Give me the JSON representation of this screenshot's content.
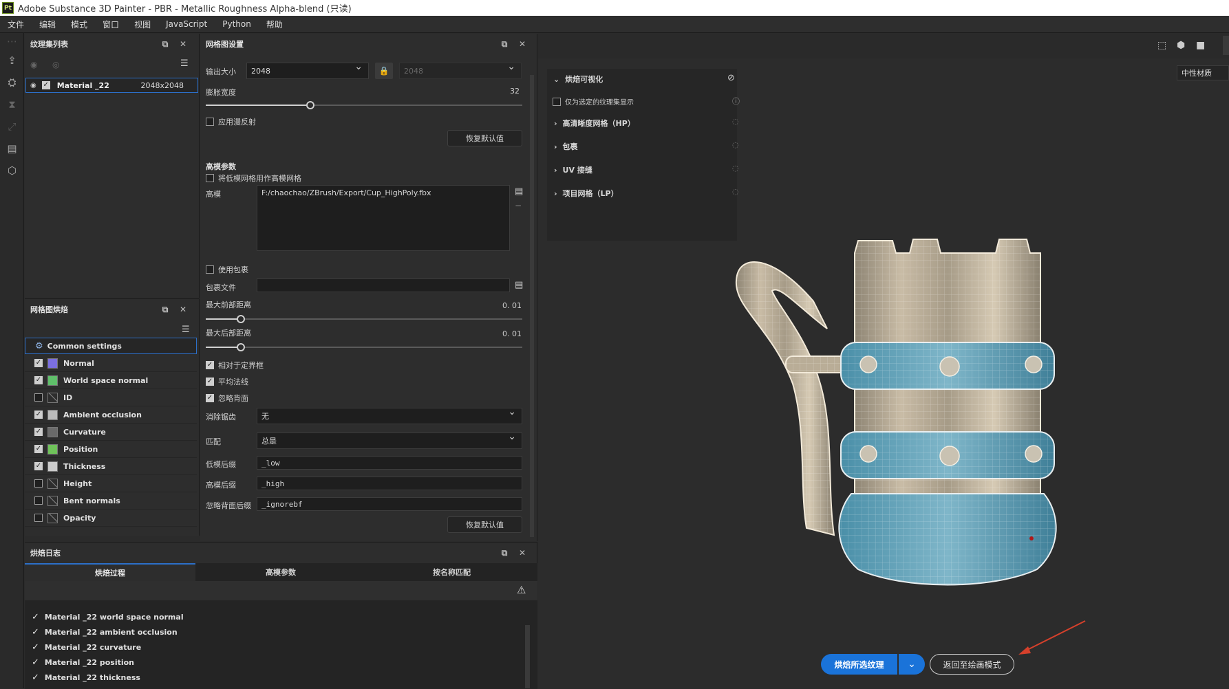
{
  "window": {
    "title": "Adobe Substance 3D Painter - PBR - Metallic Roughness Alpha-blend (只读)",
    "logo": "Pt"
  },
  "menu": [
    "文件",
    "编辑",
    "模式",
    "窗口",
    "视图",
    "JavaScript",
    "Python",
    "帮助"
  ],
  "texture_sets": {
    "title": "纹理集列表",
    "item": {
      "name": "Material _22",
      "size": "2048x2048"
    }
  },
  "mesh_settings": {
    "title": "网格图设置",
    "output_size_label": "输出大小",
    "output_size": "2048",
    "output_size_locked": "2048",
    "dilation_label": "膨胀宽度",
    "dilation_value": "32",
    "dilation_fraction": 0.33,
    "apply_diffusion_label": "应用漫反射",
    "reset_label": "恢复默认值",
    "highpoly_section": "高模参数",
    "use_lowpoly_label": "将低模网格用作高模网格",
    "highpoly_label": "高模",
    "highpoly_path": "F:/chaochao/ZBrush/Export/Cup_HighPoly.fbx",
    "use_cage_label": "使用包裹",
    "cage_file_label": "包裹文件",
    "max_front_label": "最大前部距离",
    "max_front_value": "0. 01",
    "max_front_fraction": 0.11,
    "max_rear_label": "最大后部距离",
    "max_rear_value": "0. 01",
    "max_rear_fraction": 0.11,
    "relative_bbox_label": "相对于定界框",
    "average_normals_label": "平均法线",
    "ignore_backface_label": "忽略背面",
    "antialias_label": "消除锯齿",
    "antialias_value": "无",
    "match_label": "匹配",
    "match_value": "总是",
    "low_suffix_label": "低模后缀",
    "low_suffix": "_low",
    "high_suffix_label": "高模后缀",
    "high_suffix": "_high",
    "ignore_suffix_label": "忽略背面后缀",
    "ignore_suffix": "_ignorebf",
    "reset_label2": "恢复默认值"
  },
  "bakers": {
    "title": "网格图烘焙",
    "common": "Common settings",
    "items": [
      {
        "label": "Normal",
        "checked": true,
        "icon": "normal-map-icon",
        "color": "#7b6fe0"
      },
      {
        "label": "World space normal",
        "checked": true,
        "icon": "world-normal-map-icon",
        "color": "#5fbf6a"
      },
      {
        "label": "ID",
        "checked": false,
        "icon": "id-map-icon",
        "color": ""
      },
      {
        "label": "Ambient occlusion",
        "checked": true,
        "icon": "ao-map-icon",
        "color": "#bbbbbb"
      },
      {
        "label": "Curvature",
        "checked": true,
        "icon": "curvature-map-icon",
        "color": "#6a6a6a"
      },
      {
        "label": "Position",
        "checked": true,
        "icon": "position-map-icon",
        "color": "#6fc25a"
      },
      {
        "label": "Thickness",
        "checked": true,
        "icon": "thickness-map-icon",
        "color": "#cccccc"
      },
      {
        "label": "Height",
        "checked": false,
        "icon": "height-map-icon",
        "color": ""
      },
      {
        "label": "Bent normals",
        "checked": false,
        "icon": "bent-normals-map-icon",
        "color": ""
      },
      {
        "label": "Opacity",
        "checked": false,
        "icon": "opacity-map-icon",
        "color": ""
      }
    ]
  },
  "log": {
    "title": "烘焙日志",
    "tabs": [
      "烘焙过程",
      "高模参数",
      "按名称匹配"
    ],
    "lines": [
      "Material _22 world space normal",
      "Material _22 ambient occlusion",
      "Material _22 curvature",
      "Material _22 position",
      "Material _22 thickness"
    ]
  },
  "viewport": {
    "material_mode": "中性材质",
    "bake_vis": "烘焙可视化",
    "only_selected": "仅为选定的纹理集显示",
    "tree": [
      "高清晰度网格（HP）",
      "包裹",
      "UV 接缝",
      "项目网格（LP）"
    ],
    "bake_button": "烘焙所选纹理",
    "return_button": "返回至绘画模式"
  },
  "colors": {
    "accent": "#1a73d9",
    "arrow": "#d6402b"
  }
}
